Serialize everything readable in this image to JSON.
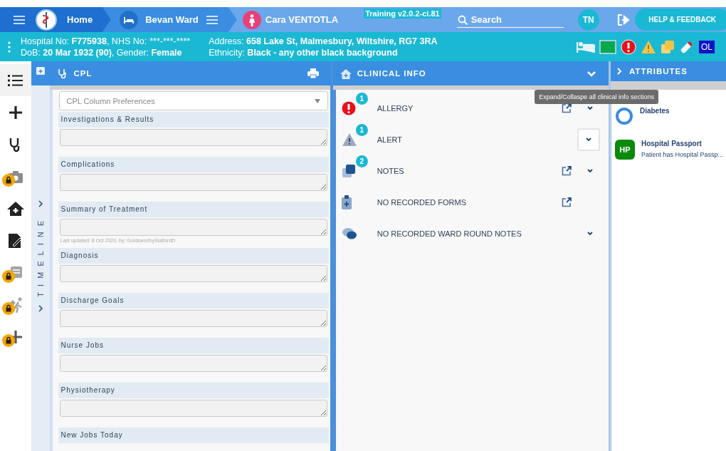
{
  "nav": {
    "home": "Home",
    "ward": "Bevan Ward",
    "patient": "Cara VENTOTLA",
    "version": "Training v2.0.2-ci.81",
    "search": {
      "placeholder": "Search"
    },
    "user_initials": "TN",
    "help": "HELP & FEEDBACK"
  },
  "banner": {
    "line1": "Hospital No: **F775938**, NHS No:",
    "nhs": "***-***-****",
    "line2": "DoB: **20 Mar 1932 (90)**, Gender: **Female**",
    "line3": "Address: **658 Lake St, Malmesbury, Wiltshire, RG7 3RA**",
    "line4": "Ethnicity: **Black - any other black background**",
    "flags": [
      {
        "kind": "bed"
      },
      {
        "kind": "square",
        "color": "#0aa84f"
      },
      {
        "kind": "allergy"
      },
      {
        "kind": "warning"
      },
      {
        "kind": "notes"
      },
      {
        "kind": "pill"
      },
      {
        "kind": "label",
        "text": "OL"
      }
    ]
  },
  "rail": [
    {
      "kind": "list",
      "locked": false,
      "selected": true
    },
    {
      "kind": "plus",
      "locked": false,
      "selected": false
    },
    {
      "kind": "stethoscope",
      "locked": false,
      "selected": false
    },
    {
      "kind": "camera",
      "locked": true,
      "selected": false
    },
    {
      "kind": "home",
      "locked": false,
      "selected": false
    },
    {
      "kind": "sign",
      "locked": false,
      "selected": false
    },
    {
      "kind": "forms",
      "locked": true,
      "selected": false
    },
    {
      "kind": "walk",
      "locked": true,
      "selected": false
    },
    {
      "kind": "plus",
      "locked": true,
      "selected": false
    }
  ],
  "timeline": {
    "label": "TIMELINE"
  },
  "cpl": {
    "title": "CPL",
    "preferences": {
      "placeholder": "CPL Column Preferences"
    },
    "sections": [
      {
        "label": "Investigations & Results"
      },
      {
        "label": "Complications"
      },
      {
        "label": "Summary of Treatment",
        "note": "Last updated: 8 Oct 2020, by: GoldsworthySlatfordD"
      },
      {
        "label": "Diagnosis"
      },
      {
        "label": "Discharge Goals"
      },
      {
        "label": "Nurse Jobs"
      },
      {
        "label": "Physiotherapy"
      },
      {
        "label": "New Jobs Today",
        "field": false
      }
    ]
  },
  "clinical": {
    "title": "CLINICAL INFO",
    "tooltip": "Expand/Collaspe all clinical info sections",
    "sections": [
      {
        "kind": "allergy",
        "label": "ALLERGY",
        "count": "1",
        "link": true,
        "chevron": true,
        "focused": false
      },
      {
        "kind": "alert",
        "label": "ALERT",
        "count": "1",
        "link": false,
        "chevron": true,
        "focused": true
      },
      {
        "kind": "notes",
        "label": "NOTES",
        "count": "2",
        "link": true,
        "chevron": true,
        "focused": false
      },
      {
        "kind": "forms",
        "label": "NO RECORDED FORMS",
        "link": true,
        "chevron": false
      },
      {
        "kind": "chat",
        "label": "NO RECORDED WARD ROUND NOTES",
        "link": false,
        "chevron": true,
        "focused": false
      }
    ]
  },
  "attributes": {
    "title": "ATTRIBUTES",
    "items": [
      {
        "kind": "ring",
        "title": "Diabetes"
      },
      {
        "kind": "badge",
        "badge": "HP",
        "title": "Hospital Passport",
        "text": "Patient has Hospital Passp..."
      }
    ]
  }
}
